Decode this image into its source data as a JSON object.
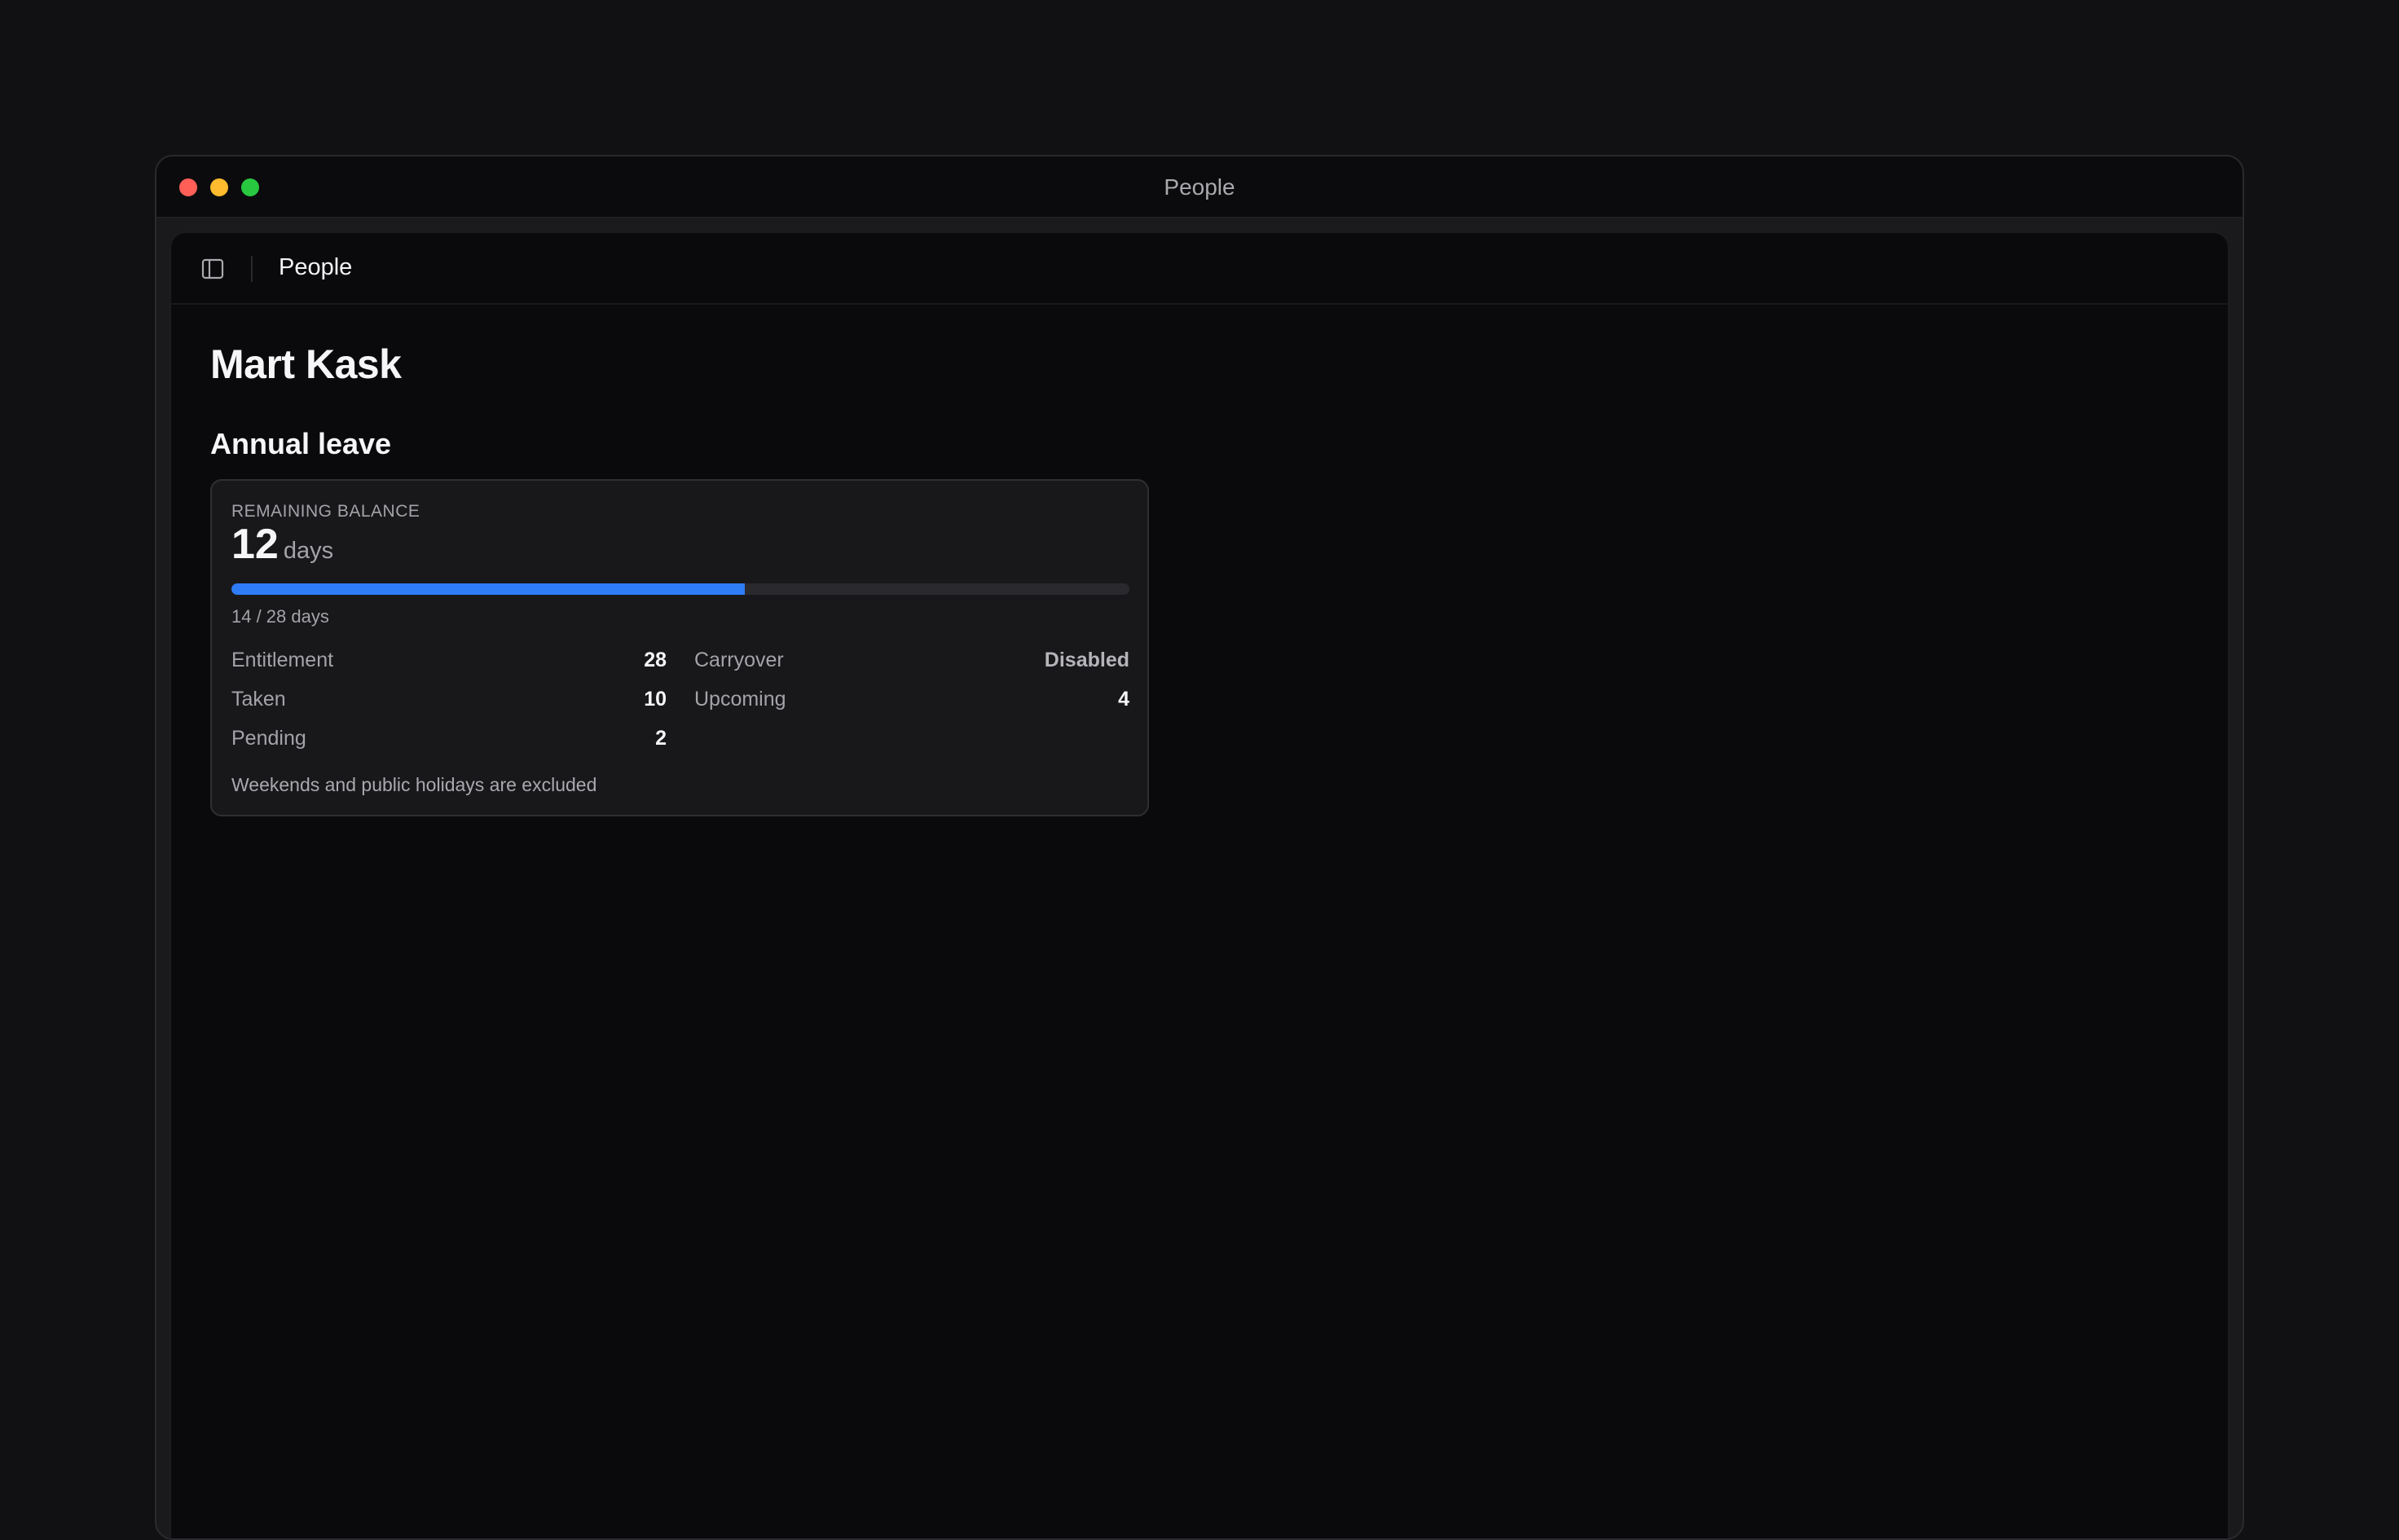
{
  "window": {
    "title": "People"
  },
  "header": {
    "sidebar_toggle_icon": "sidebar-toggle-icon",
    "title": "People"
  },
  "person": {
    "name": "Mart Kask"
  },
  "annual_leave": {
    "section_title": "Annual leave",
    "remaining_label": "REMAINING BALANCE",
    "remaining_value": "12",
    "remaining_unit": "days",
    "progress": {
      "used": 14,
      "total": 28,
      "text": "14 / 28 days",
      "fill_fraction": 0.572,
      "color": "#2e7cf6"
    },
    "stats_left": [
      {
        "label": "Entitlement",
        "value": "28"
      },
      {
        "label": "Taken",
        "value": "10"
      },
      {
        "label": "Pending",
        "value": "2"
      }
    ],
    "stats_right": [
      {
        "label": "Carryover",
        "value": "Disabled"
      },
      {
        "label": "Upcoming",
        "value": "4"
      }
    ],
    "note": "Weekends and public holidays are excluded"
  }
}
